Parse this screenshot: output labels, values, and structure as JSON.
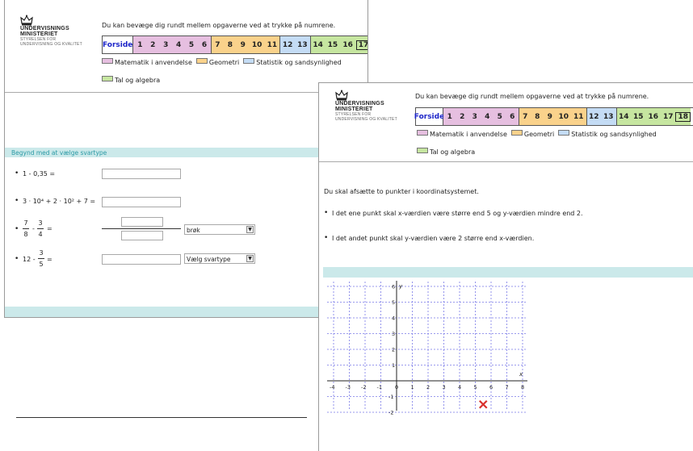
{
  "logo": {
    "line1": "UNDERVISNINGS",
    "line2": "MINISTERIET",
    "line3": "STYRELSEN FOR",
    "line4": "UNDERVISNING OG KVALITET"
  },
  "colors": {
    "matematik": "#e6bfe0",
    "geometri": "#fad28b",
    "statistik": "#c4dcf5",
    "tal": "#c6e6a0",
    "teal_bar": "#cbe9ea",
    "red_mark": "#d9302b"
  },
  "left": {
    "intro": "Du kan bevæge dig rundt mellem opgaverne ved at trykke på numrene.",
    "nav_home": "Forside",
    "nav": [
      {
        "label": "1",
        "cat": "matematik"
      },
      {
        "label": "2",
        "cat": "matematik"
      },
      {
        "label": "3",
        "cat": "matematik"
      },
      {
        "label": "4",
        "cat": "matematik"
      },
      {
        "label": "5",
        "cat": "matematik"
      },
      {
        "label": "6",
        "cat": "matematik"
      },
      {
        "label": "7",
        "cat": "geometri"
      },
      {
        "label": "8",
        "cat": "geometri"
      },
      {
        "label": "9",
        "cat": "geometri"
      },
      {
        "label": "10",
        "cat": "geometri"
      },
      {
        "label": "11",
        "cat": "geometri"
      },
      {
        "label": "12",
        "cat": "statistik"
      },
      {
        "label": "13",
        "cat": "statistik"
      },
      {
        "label": "14",
        "cat": "tal"
      },
      {
        "label": "15",
        "cat": "tal"
      },
      {
        "label": "16",
        "cat": "tal"
      },
      {
        "label": "17",
        "cat": "tal",
        "current": true
      }
    ],
    "legend": {
      "matematik": "Matematik i anvendelse",
      "geometri": "Geometri",
      "statistik": "Statistik og sandsynlighed",
      "tal": "Tal og algebra"
    },
    "section_title": "Begynd med at vælge svartype",
    "q1": "1 - 0,35 =",
    "q2": "3 · 10⁴ + 2 · 10² + 7 =",
    "q3": {
      "n1": "7",
      "d1": "8",
      "op": "-",
      "n2": "3",
      "d2": "4",
      "eq": "="
    },
    "q3_select": "brøk",
    "q4": {
      "prefix": "12 -",
      "n": "3",
      "d": "5",
      "eq": "="
    },
    "q4_select": "Vælg svartype"
  },
  "right": {
    "intro": "Du kan bevæge dig rundt mellem opgaverne ved at trykke på numrene.",
    "nav_home": "Forside",
    "nav": [
      {
        "label": "1",
        "cat": "matematik"
      },
      {
        "label": "2",
        "cat": "matematik"
      },
      {
        "label": "3",
        "cat": "matematik"
      },
      {
        "label": "4",
        "cat": "matematik"
      },
      {
        "label": "5",
        "cat": "matematik"
      },
      {
        "label": "6",
        "cat": "matematik"
      },
      {
        "label": "7",
        "cat": "geometri"
      },
      {
        "label": "8",
        "cat": "geometri"
      },
      {
        "label": "9",
        "cat": "geometri"
      },
      {
        "label": "10",
        "cat": "geometri"
      },
      {
        "label": "11",
        "cat": "geometri"
      },
      {
        "label": "12",
        "cat": "statistik"
      },
      {
        "label": "13",
        "cat": "statistik"
      },
      {
        "label": "14",
        "cat": "tal"
      },
      {
        "label": "15",
        "cat": "tal"
      },
      {
        "label": "16",
        "cat": "tal"
      },
      {
        "label": "17",
        "cat": "tal"
      },
      {
        "label": "18",
        "cat": "tal",
        "current": true
      }
    ],
    "legend": {
      "matematik": "Matematik i anvendelse",
      "geometri": "Geometri",
      "statistik": "Statistik og sandsynlighed",
      "tal": "Tal og algebra"
    },
    "task": "Du skal afsætte to punkter i koordinatsystemet.",
    "bullet1": "I det ene punkt skal x-værdien være større end 5 og y-værdien mindre end 2.",
    "bullet2": "I det andet punkt skal y-værdien være 2 større end x-værdien.",
    "grid": {
      "x_min": -4,
      "x_max": 8,
      "y_min": -2,
      "y_max": 6,
      "x_label": "x",
      "y_label": "y",
      "x_ticks": [
        "-4",
        "-3",
        "-2",
        "-1",
        "0",
        "1",
        "2",
        "3",
        "4",
        "5",
        "6",
        "7",
        "8"
      ],
      "y_ticks": [
        "6",
        "5",
        "4",
        "3",
        "2",
        "1",
        "-1",
        "-2"
      ],
      "placed_point": {
        "x": 5.5,
        "y": -1.5
      }
    }
  }
}
